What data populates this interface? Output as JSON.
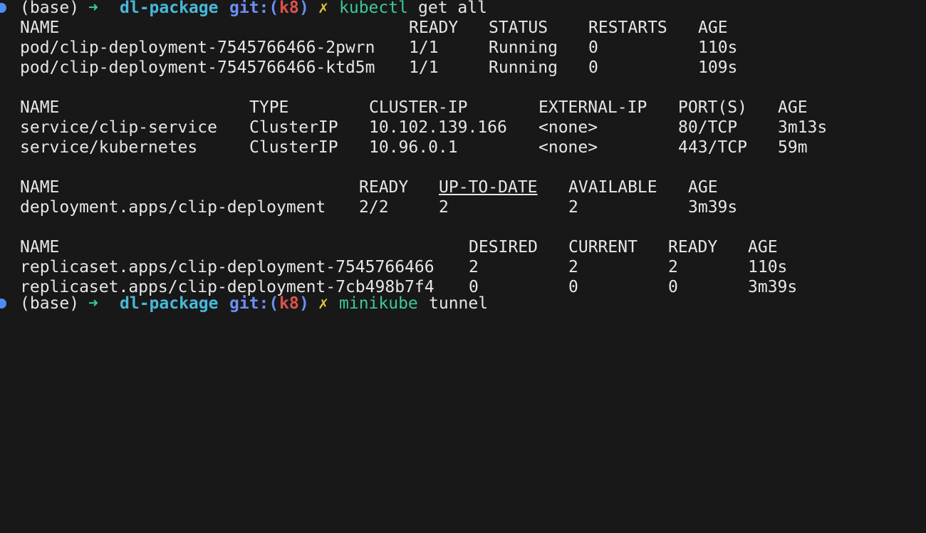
{
  "prompt": {
    "env": "(base)",
    "arrow": "➜",
    "dir": "dl-package",
    "git_label": "git:(",
    "branch": "k8",
    "git_close": ")",
    "dirty_mark": "✗"
  },
  "command1": {
    "cmd": "kubectl",
    "args": "get all"
  },
  "pods": {
    "headers": [
      "NAME",
      "READY",
      "STATUS",
      "RESTARTS",
      "AGE"
    ],
    "rows": [
      [
        "pod/clip-deployment-7545766466-2pwrn",
        "1/1",
        "Running",
        "0",
        "110s"
      ],
      [
        "pod/clip-deployment-7545766466-ktd5m",
        "1/1",
        "Running",
        "0",
        "109s"
      ]
    ]
  },
  "services": {
    "headers": [
      "NAME",
      "TYPE",
      "CLUSTER-IP",
      "EXTERNAL-IP",
      "PORT(S)",
      "AGE"
    ],
    "rows": [
      [
        "service/clip-service",
        "ClusterIP",
        "10.102.139.166",
        "<none>",
        "80/TCP",
        "3m13s"
      ],
      [
        "service/kubernetes",
        "ClusterIP",
        "10.96.0.1",
        "<none>",
        "443/TCP",
        "59m"
      ]
    ]
  },
  "deployments": {
    "headers": [
      "NAME",
      "READY",
      "UP-TO-DATE",
      "AVAILABLE",
      "AGE"
    ],
    "rows": [
      [
        "deployment.apps/clip-deployment",
        "2/2",
        "2",
        "2",
        "3m39s"
      ]
    ]
  },
  "replicasets": {
    "headers": [
      "NAME",
      "DESIRED",
      "CURRENT",
      "READY",
      "AGE"
    ],
    "rows": [
      [
        "replicaset.apps/clip-deployment-7545766466",
        "2",
        "2",
        "2",
        "110s"
      ],
      [
        "replicaset.apps/clip-deployment-7cb498b7f4",
        "0",
        "0",
        "0",
        "3m39s"
      ]
    ]
  },
  "command2": {
    "cmd": "minikube",
    "args": "tunnel"
  },
  "colors": {
    "background": "#181818",
    "text": "#e6e6e6",
    "prompt_dot": "#4d8ef5",
    "arrow": "#3cc99a",
    "dir": "#47b8d9",
    "git": "#6c8ef5",
    "branch": "#e0524f",
    "dirty": "#e8c33a",
    "command": "#3cc99a"
  }
}
